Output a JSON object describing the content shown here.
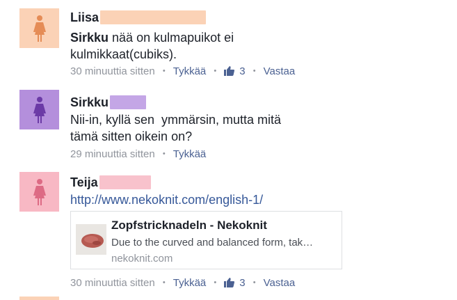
{
  "colors": {
    "avatar_liisa_bg": "#fbd2b6",
    "avatar_liisa_fg": "#e58c56",
    "avatar_sirkku_bg": "#b48fdc",
    "avatar_sirkku_fg": "#6b3aa6",
    "avatar_teija_bg": "#f8b8c4",
    "avatar_teija_fg": "#dd6a84",
    "redact_liisa": "#fbd2b6",
    "redact_sirkku": "#c4a6e6",
    "redact_teija": "#f8c2cc",
    "link": "#365899",
    "meta": "#90949c"
  },
  "comments": [
    {
      "name": "Liisa",
      "mention": "Sirkku",
      "text_rest": " nää on kulmapuikot ei",
      "text_line2": "kulmikkaat(cubiks).",
      "time": "30 minuuttia sitten",
      "like_action": "Tykkää",
      "like_count": "3",
      "reply_action": "Vastaa",
      "avatar_icon": "female-person-icon"
    },
    {
      "name": "Sirkku",
      "text_line1": "Nii-in, kyllä sen  ymmärsin, mutta mitä",
      "text_line2": "tämä sitten oikein on?",
      "time": "29 minuuttia sitten",
      "like_action": "Tykkää",
      "avatar_icon": "female-person-icon"
    },
    {
      "name": "Teija",
      "link": "http://www.nekoknit.com/english-1/",
      "preview": {
        "title": "Zopfstricknadeln - Nekoknit",
        "description": "Due to the curved and balanced form, tak…",
        "domain": "nekoknit.com"
      },
      "time": "30 minuuttia sitten",
      "like_action": "Tykkää",
      "like_count": "3",
      "reply_action": "Vastaa",
      "avatar_icon": "female-person-icon"
    }
  ]
}
